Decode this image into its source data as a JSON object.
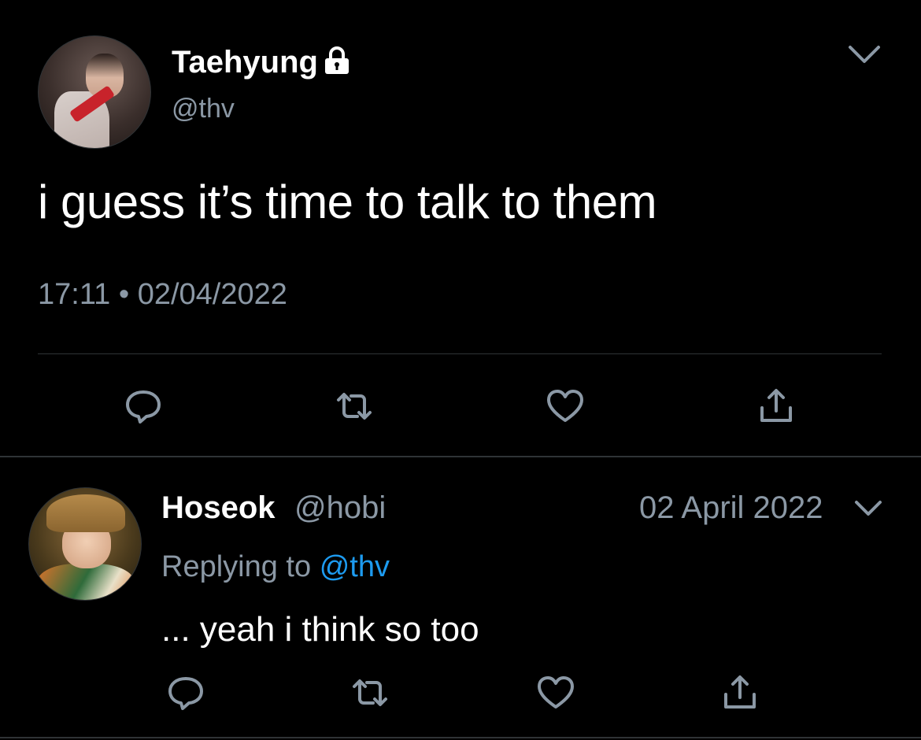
{
  "colors": {
    "background": "#000000",
    "text_primary": "#ffffff",
    "text_secondary": "#8b98a5",
    "link": "#1d9bf0",
    "divider": "#2f3336"
  },
  "main_tweet": {
    "author": {
      "display_name": "Taehyung",
      "handle": "@thv",
      "protected_icon": "lock-icon",
      "avatar": "profile-photo"
    },
    "text": "i guess it’s time to talk to them",
    "timestamp": "17:11 • 02/04/2022",
    "menu_icon": "chevron-down-icon",
    "actions": [
      {
        "name": "reply",
        "icon": "comment-icon"
      },
      {
        "name": "retweet",
        "icon": "retweet-icon"
      },
      {
        "name": "like",
        "icon": "heart-icon"
      },
      {
        "name": "share",
        "icon": "share-icon"
      }
    ]
  },
  "reply_tweet": {
    "author": {
      "display_name": "Hoseok",
      "handle": "@hobi",
      "avatar": "profile-photo"
    },
    "date": "02 April 2022",
    "replying_to_prefix": "Replying to",
    "replying_to_handle": "@thv",
    "text": "... yeah i think so too",
    "menu_icon": "chevron-down-icon",
    "actions": [
      {
        "name": "reply",
        "icon": "comment-icon"
      },
      {
        "name": "retweet",
        "icon": "retweet-icon"
      },
      {
        "name": "like",
        "icon": "heart-icon"
      },
      {
        "name": "share",
        "icon": "share-icon"
      }
    ]
  }
}
